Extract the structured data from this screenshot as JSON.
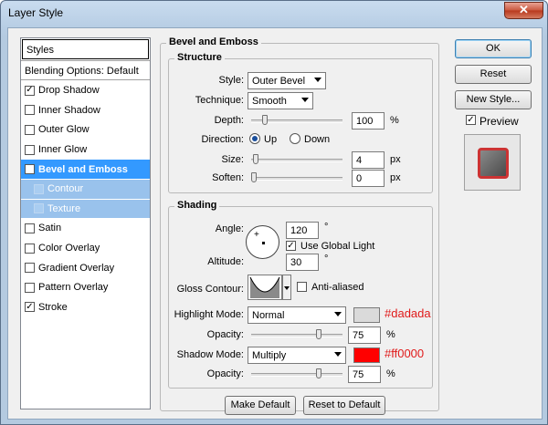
{
  "window": {
    "title": "Layer Style",
    "close_glyph": "✕"
  },
  "styles_panel": {
    "header": "Styles",
    "blending": "Blending Options: Default",
    "items": [
      {
        "label": "Drop Shadow",
        "checked": true
      },
      {
        "label": "Inner Shadow",
        "checked": false
      },
      {
        "label": "Outer Glow",
        "checked": false
      },
      {
        "label": "Inner Glow",
        "checked": false
      },
      {
        "label": "Bevel and Emboss",
        "checked": true
      },
      {
        "label": "Contour",
        "checked": false
      },
      {
        "label": "Texture",
        "checked": false
      },
      {
        "label": "Satin",
        "checked": false
      },
      {
        "label": "Color Overlay",
        "checked": false
      },
      {
        "label": "Gradient Overlay",
        "checked": false
      },
      {
        "label": "Pattern Overlay",
        "checked": false
      },
      {
        "label": "Stroke",
        "checked": true
      }
    ]
  },
  "bevel": {
    "title": "Bevel and Emboss",
    "structure": {
      "title": "Structure",
      "style_label": "Style:",
      "style_value": "Outer Bevel",
      "technique_label": "Technique:",
      "technique_value": "Smooth",
      "depth_label": "Depth:",
      "depth_value": "100",
      "depth_unit": "%",
      "direction_label": "Direction:",
      "direction_up": "Up",
      "direction_down": "Down",
      "size_label": "Size:",
      "size_value": "4",
      "size_unit": "px",
      "soften_label": "Soften:",
      "soften_value": "0",
      "soften_unit": "px"
    },
    "shading": {
      "title": "Shading",
      "angle_label": "Angle:",
      "angle_value": "120",
      "angle_unit": "°",
      "global_light": "Use Global Light",
      "altitude_label": "Altitude:",
      "altitude_value": "30",
      "altitude_unit": "°",
      "gloss_label": "Gloss Contour:",
      "anti_aliased": "Anti-aliased",
      "highlight_label": "Highlight Mode:",
      "highlight_value": "Normal",
      "highlight_opacity_label": "Opacity:",
      "highlight_opacity": "75",
      "highlight_opacity_unit": "%",
      "highlight_color": "#dadada",
      "highlight_hex": "#dadada",
      "shadow_label": "Shadow Mode:",
      "shadow_value": "Multiply",
      "shadow_opacity_label": "Opacity:",
      "shadow_opacity": "75",
      "shadow_opacity_unit": "%",
      "shadow_color": "#ff0000",
      "shadow_hex": "#ff0000"
    },
    "make_default": "Make Default",
    "reset_default": "Reset to Default"
  },
  "buttons": {
    "ok": "OK",
    "reset": "Reset",
    "new_style": "New Style...",
    "preview": "Preview"
  }
}
